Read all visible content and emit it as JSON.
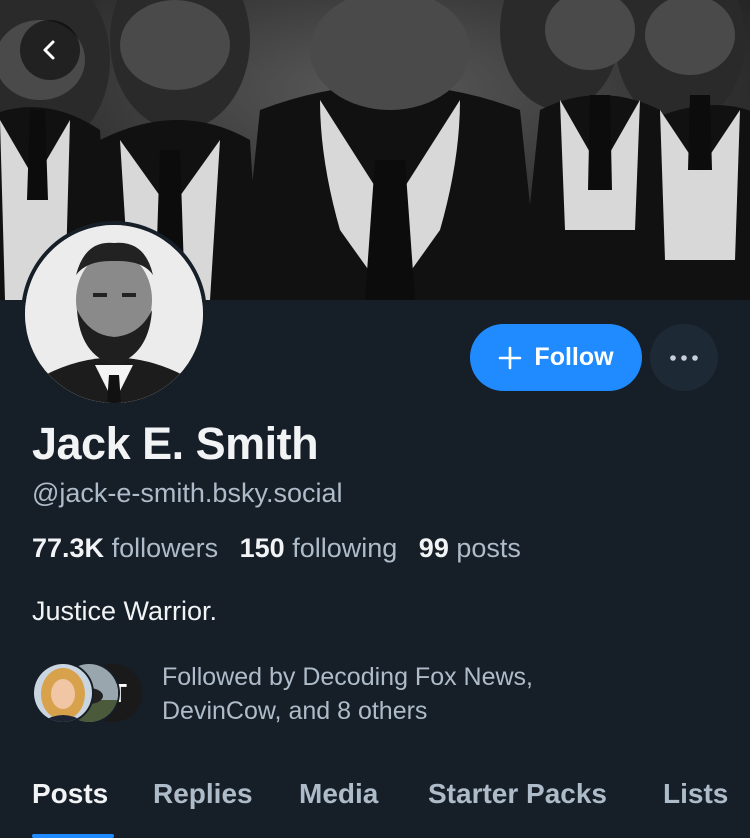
{
  "header": {
    "back_icon": "chevron-left-icon"
  },
  "profile": {
    "display_name": "Jack E. Smith",
    "handle": "@jack-e-smith.bsky.social",
    "bio": "Justice Warrior.",
    "follow_label": "Follow",
    "follow_icon": "plus-icon",
    "more_icon": "ellipsis-icon",
    "stats": {
      "followers_count": "77.3K",
      "followers_label": "followers",
      "following_count": "150",
      "following_label": "following",
      "posts_count": "99",
      "posts_label": "posts"
    },
    "followed_by": {
      "line1": "Followed by Decoding Fox News,",
      "line2": "DevinCow, and 8 others",
      "third_avatar_letter": "T"
    }
  },
  "tabs": [
    {
      "label": "Posts",
      "active": true
    },
    {
      "label": "Replies",
      "active": false
    },
    {
      "label": "Media",
      "active": false
    },
    {
      "label": "Starter Packs",
      "active": false
    },
    {
      "label": "Lists",
      "active": false
    }
  ],
  "colors": {
    "background": "#161e27",
    "accent": "#208bfe",
    "text_primary": "#f1f3f5",
    "text_secondary": "#aebbc9"
  }
}
